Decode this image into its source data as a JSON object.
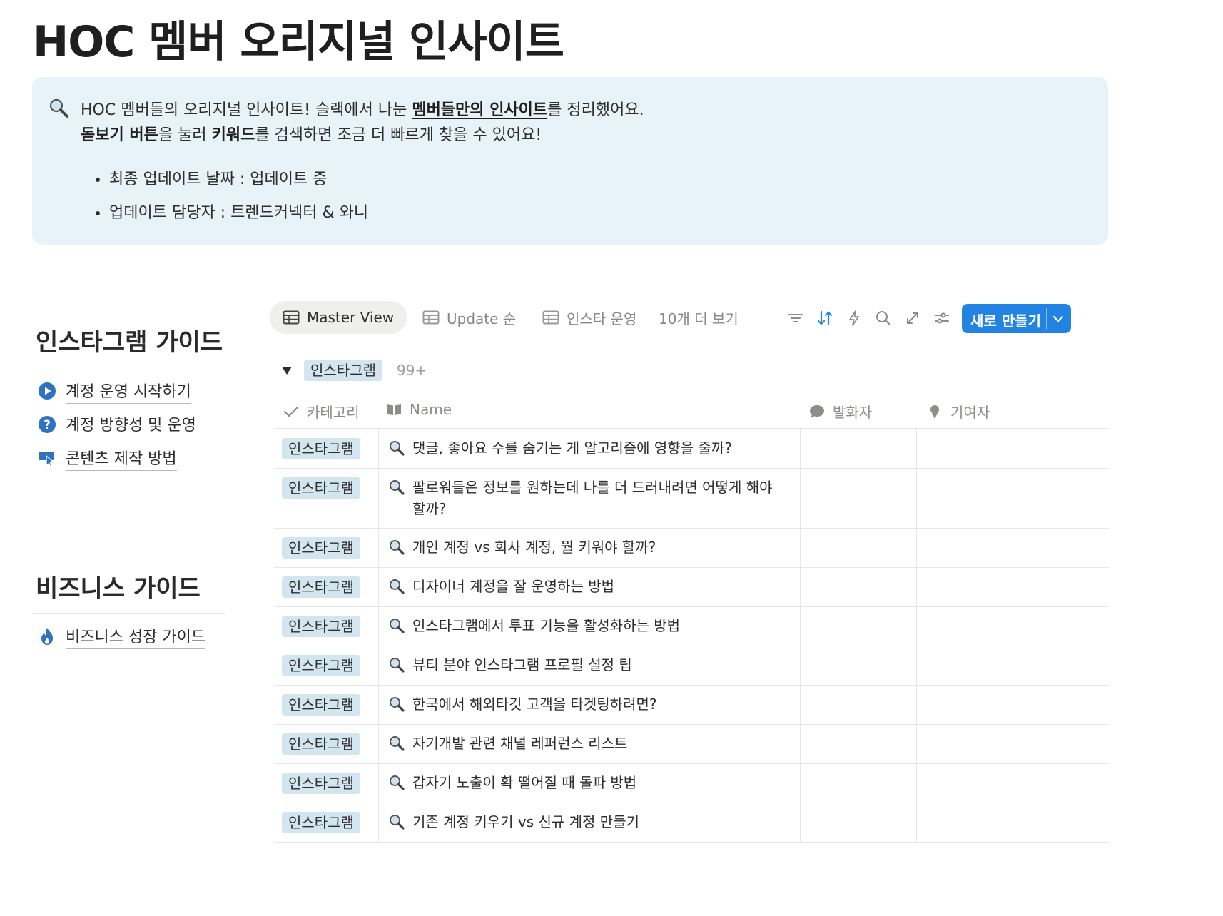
{
  "page": {
    "title": "HOC 멤버 오리지널 인사이트"
  },
  "callout": {
    "line1_pre": "HOC 멤버들의 오리지널 인사이트! 슬랙에서 나눈 ",
    "line1_bold": "멤버들만의 인사이트",
    "line1_post": "를 정리했어요.",
    "line2_bold1": "돋보기 버튼",
    "line2_mid1": "을 눌러 ",
    "line2_bold2": "키워드",
    "line2_post": "를 검색하면 조금 더 빠르게 찾을 수 있어요!",
    "bullets": [
      "최종 업데이트 날짜 : 업데이트 중",
      "업데이트 담당자 : 트렌드커넥터 & 와니"
    ]
  },
  "sidebar": {
    "instagram_heading": "인스타그램 가이드",
    "instagram_links": [
      "계정 운영 시작하기",
      "계정 방향성 및 운영",
      "콘텐츠 제작 방법"
    ],
    "business_heading": "비즈니스 가이드",
    "business_links": [
      "비즈니스 성장 가이드"
    ]
  },
  "views": {
    "tabs": [
      "Master View",
      "Update 순",
      "인스타 운영"
    ],
    "more": "10개 더 보기",
    "new_button": "새로 만들기"
  },
  "group": {
    "label": "인스타그램",
    "count": "99+"
  },
  "table": {
    "columns": [
      "카테고리",
      "Name",
      "발화자",
      "기여자"
    ],
    "rows": [
      {
        "category": "인스타그램",
        "name": "댓글, 좋아요 수를 숨기는 게 알고리즘에 영향을 줄까?"
      },
      {
        "category": "인스타그램",
        "name": "팔로워들은 정보를 원하는데 나를 더 드러내려면 어떻게 해야할까?"
      },
      {
        "category": "인스타그램",
        "name": "개인 계정 vs 회사 계정, 뭘 키워야 할까?"
      },
      {
        "category": "인스타그램",
        "name": "디자이너 계정을 잘 운영하는 방법"
      },
      {
        "category": "인스타그램",
        "name": "인스타그램에서 투표 기능을 활성화하는 방법"
      },
      {
        "category": "인스타그램",
        "name": "뷰티 분야 인스타그램 프로필 설정 팁"
      },
      {
        "category": "인스타그램",
        "name": "한국에서 해외타깃 고객을 타겟팅하려면?"
      },
      {
        "category": "인스타그램",
        "name": "자기개발 관련 채널 레퍼런스 리스트"
      },
      {
        "category": "인스타그램",
        "name": "갑자기 노출이 확 떨어질 때 돌파 방법"
      },
      {
        "category": "인스타그램",
        "name": "기존 계정 키우기 vs 신규 계정 만들기"
      }
    ]
  },
  "colors": {
    "accent": "#2383e2",
    "callout_bg": "#e7f3f8",
    "tag_bg": "#d3e5ef"
  }
}
